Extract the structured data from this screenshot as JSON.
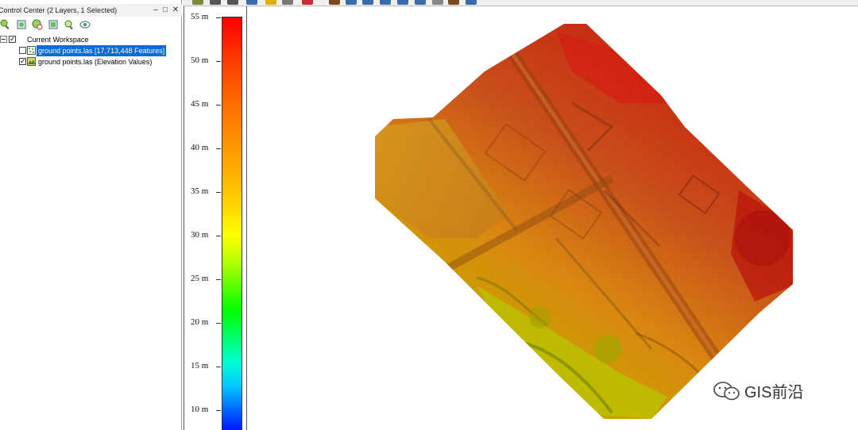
{
  "control_center": {
    "title": "Control Center (2 Layers, 1 Selected)",
    "controls": {
      "minimize": "–",
      "restore": "□",
      "close": "✕"
    },
    "tools": [
      "zoom-to-layer-icon",
      "layer-props-icon",
      "remove-layer-icon",
      "filter-icon",
      "search-icon",
      "visibility-icon"
    ],
    "tree": {
      "workspace": "Current Workspace",
      "layers": [
        {
          "label": "ground points.las [17,713,448 Features]",
          "checked": false,
          "selected": true
        },
        {
          "label": "ground points.las (Elevation Values)",
          "checked": true,
          "selected": false
        }
      ]
    }
  },
  "legend": {
    "ticks": [
      "55 m",
      "50 m",
      "45 m",
      "40 m",
      "35 m",
      "30 m",
      "25 m",
      "20 m",
      "15 m",
      "10 m"
    ],
    "colors": {
      "high": "#ff0000",
      "mid": "#ffff00",
      "green": "#00ff00",
      "low": "#0000ff"
    }
  },
  "watermark": {
    "text": "GIS前沿",
    "icon": "wechat-icon"
  }
}
